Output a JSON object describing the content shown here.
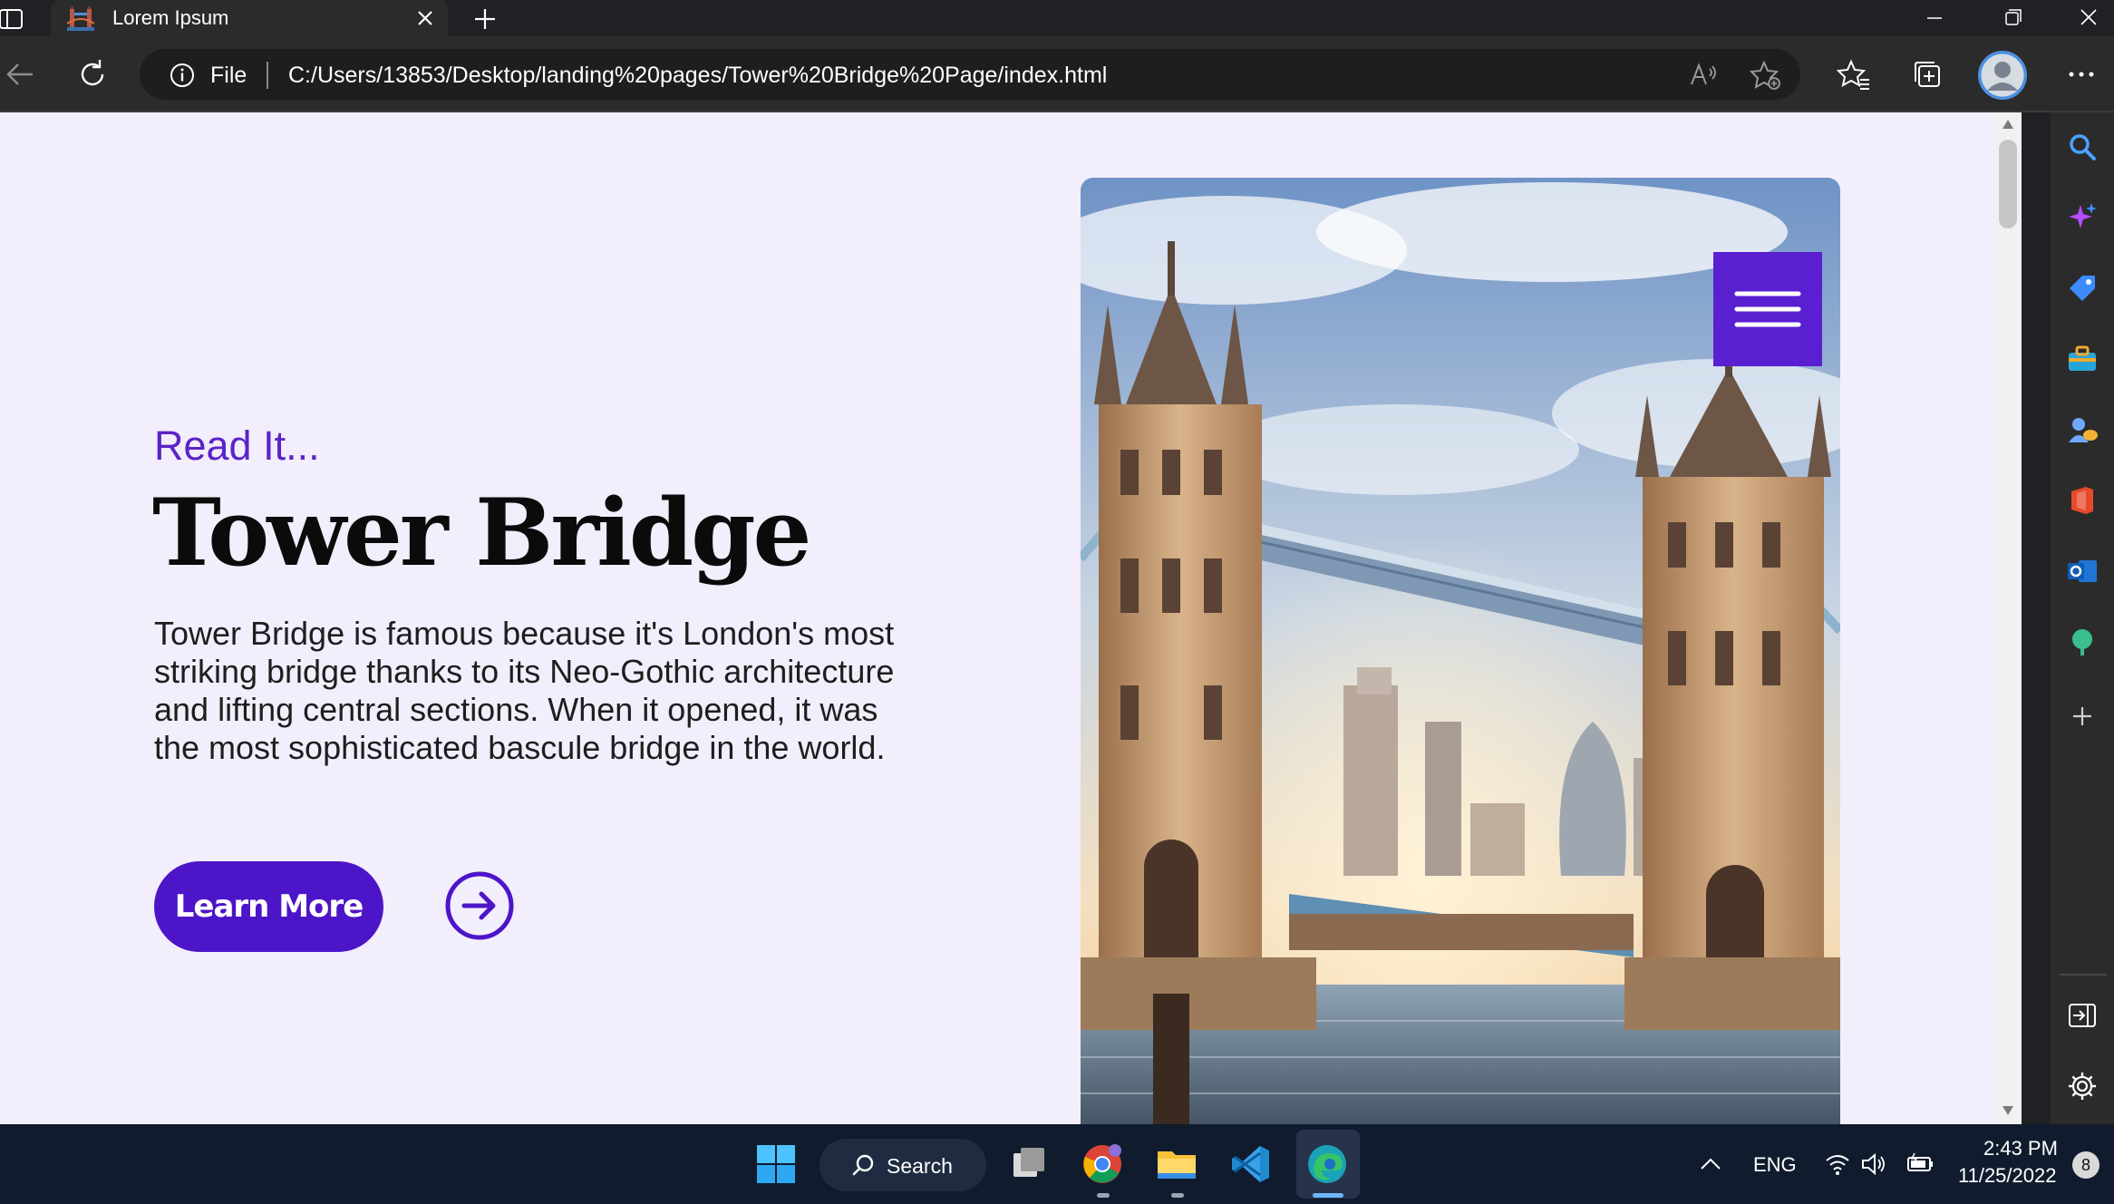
{
  "browser": {
    "tab": {
      "title": "Lorem Ipsum",
      "favicon": "tower-bridge-favicon"
    },
    "address": {
      "scheme_label": "File",
      "url": "C:/Users/13853/Desktop/landing%20pages/Tower%20Bridge%20Page/index.html"
    },
    "toolbar_icons": [
      "back-arrow-icon",
      "refresh-icon",
      "info-icon",
      "read-aloud-icon",
      "add-favorite-icon",
      "favorites-icon",
      "collections-icon",
      "profile-avatar",
      "more-icon"
    ],
    "sidebar_icons": [
      "search-icon",
      "copilot-icon",
      "shopping-tag-icon",
      "tools-briefcase-icon",
      "games-icon",
      "office-icon",
      "outlook-icon",
      "tree-icon",
      "add-icon",
      "hide-sidebar-icon",
      "settings-gear-icon"
    ]
  },
  "page": {
    "eyebrow": "Read It...",
    "title": "Tower Bridge",
    "body": "Tower Bridge is famous because it's London's most striking bridge thanks to its Neo-Gothic architecture and lifting central sections. When it opened, it was the most sophisticated bascule bridge in the world.",
    "cta_label": "Learn More",
    "image": "tower-bridge-photo",
    "colors": {
      "accent": "#4d15c8",
      "menu": "#5a1fd1",
      "background": "#f2eefb",
      "text": "#0b0b0b"
    }
  },
  "taskbar": {
    "search_label": "Search",
    "apps": [
      "start-windows-icon",
      "task-view-icon",
      "chrome-icon",
      "file-explorer-icon",
      "vscode-icon",
      "edge-icon"
    ],
    "language": "ENG",
    "time": "2:43 PM",
    "date": "11/25/2022",
    "notifications": "8"
  }
}
